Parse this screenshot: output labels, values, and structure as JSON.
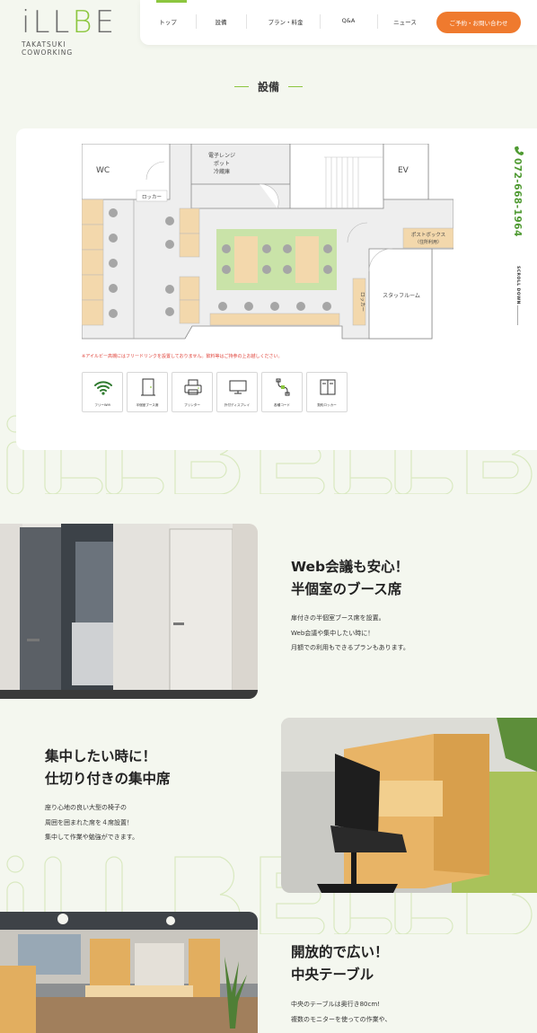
{
  "header": {
    "logo_main_a": "iLL",
    "logo_main_b": "B",
    "logo_main_c": "E",
    "logo_sub": "TAKATSUKI COWORKING",
    "nav": [
      "トップ",
      "設備",
      "プラン・料金",
      "Q&A",
      "ニュース"
    ],
    "cta": "ご予約・お問い合わせ",
    "accent_color": "#8cc63f",
    "cta_color": "#ef7a2e"
  },
  "section": {
    "title": "設備"
  },
  "floor_plan": {
    "wc": "WC",
    "ev": "EV",
    "kitchen": [
      "電子レンジ",
      "ポット",
      "冷蔵庫"
    ],
    "locker_top": "ロッカー",
    "locker_side": "ロッカー",
    "postbox": [
      "ポストボックス",
      "（住所利用）"
    ],
    "staff": "スタッフルーム"
  },
  "notice": "※アイルビー高槻にはフリードリンクを設置しておりません。飲料等はご持参の上お越しください。",
  "amenities": [
    {
      "label": "フリーWifi",
      "icon": "wifi-icon"
    },
    {
      "label": "半個室ブース席",
      "icon": "door-icon"
    },
    {
      "label": "プリンター",
      "icon": "printer-icon"
    },
    {
      "label": "外付ディスプレイ",
      "icon": "monitor-icon"
    },
    {
      "label": "各種コード",
      "icon": "cable-icon"
    },
    {
      "label": "契約ロッカー",
      "icon": "locker-icon"
    }
  ],
  "side": {
    "phone": "072-668-1964",
    "scroll": "SCROLL DOWN",
    "phone_icon": "phone-icon"
  },
  "watermark": "iLLBE",
  "features": [
    {
      "title": [
        "Web会議も安心！",
        "半個室のブース席"
      ],
      "body": [
        "扉付きの半個室ブース席を設置。",
        "Web会議や集中したい時に！",
        "月額での利用もできるプランもあります。"
      ]
    },
    {
      "title": [
        "集中したい時に！",
        "仕切り付きの集中席"
      ],
      "body": [
        "座り心地の良い大型の椅子の",
        "周囲を囲まれた席を４席設置！",
        "集中して作業や勉強ができます。"
      ]
    },
    {
      "title": [
        "開放的で広い！",
        "中央テーブル"
      ],
      "body": [
        "中央のテーブルは奥行き80cm!",
        "複数のモニターを使っての作業や、"
      ]
    }
  ]
}
